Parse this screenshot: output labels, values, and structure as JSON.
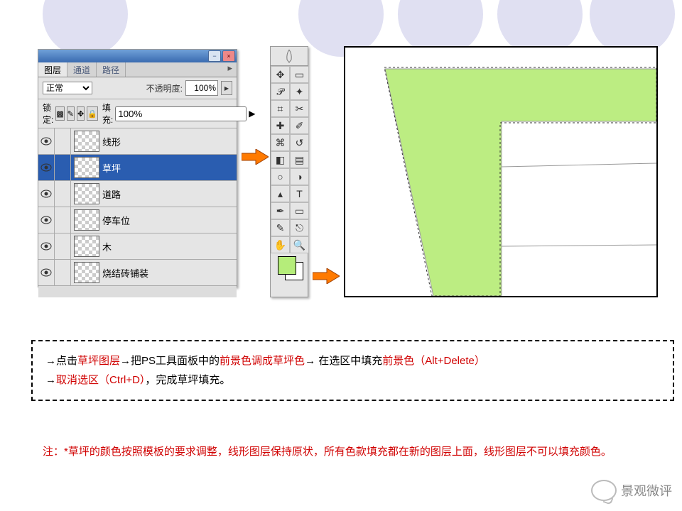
{
  "bgCircles": [
    60,
    420,
    560,
    700,
    830
  ],
  "layersPanel": {
    "tabs": [
      {
        "label": "图层",
        "active": true
      },
      {
        "label": "通道",
        "active": false
      },
      {
        "label": "路径",
        "active": false
      }
    ],
    "blendLabel": "正常",
    "opacityLabel": "不透明度:",
    "opacity": "100%",
    "lockLabel": "锁定:",
    "fillLabel": "填充:",
    "fill": "100%",
    "layers": [
      {
        "name": "线形",
        "selected": false
      },
      {
        "name": "草坪",
        "selected": true
      },
      {
        "name": "道路",
        "selected": false
      },
      {
        "name": "停车位",
        "selected": false
      },
      {
        "name": "木",
        "selected": false
      },
      {
        "name": "烧结砖铺装",
        "selected": false
      }
    ]
  },
  "toolbox": {
    "fgColor": "#b5ed7a",
    "bgColor": "#ffffff"
  },
  "instructions": {
    "arrow": "→",
    "s1": "点击",
    "h1": "草坪图层",
    "s2": "把PS工具面板中的",
    "h2": "前景色调成草坪色",
    "s3": " 在选区中填充",
    "h3": "前景色（Alt+Delete）",
    "h4": "取消选区（Ctrl+D）",
    "s4": "，完成草坪填充。"
  },
  "note": {
    "prefix": "注：",
    "body": "*草坪的颜色按照模板的要求调整，线形图层保持原状，所有色款填充都在新的图层上面，线形图层不可以填充颜色。"
  },
  "watermark": "景观微评"
}
